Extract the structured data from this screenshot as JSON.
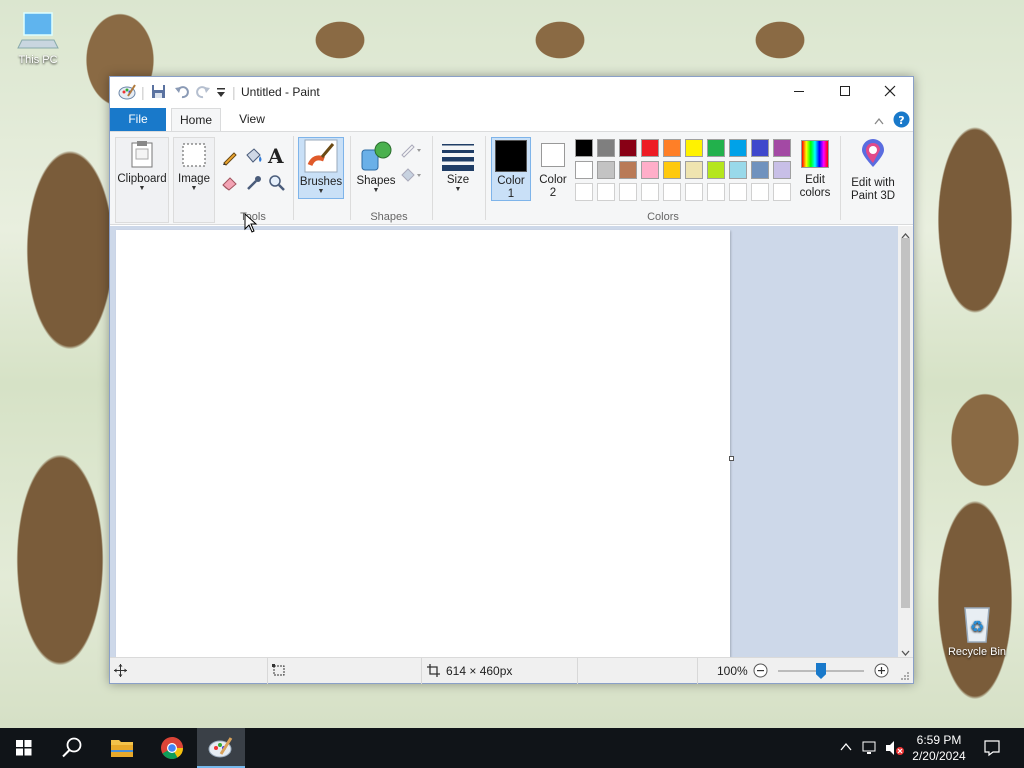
{
  "desktop": {
    "this_pc": "This PC",
    "recycle_bin": "Recycle Bin"
  },
  "window": {
    "title": "Untitled - Paint"
  },
  "tabs": {
    "file": "File",
    "home": "Home",
    "view": "View"
  },
  "ribbon": {
    "clipboard": "Clipboard",
    "image": "Image",
    "tools": "Tools",
    "brushes": "Brushes",
    "shapes_btn": "Shapes",
    "shapes_group": "Shapes",
    "size": "Size",
    "color1_a": "Color",
    "color1_b": "1",
    "color2_a": "Color",
    "color2_b": "2",
    "edit_colors_a": "Edit",
    "edit_colors_b": "colors",
    "paint3d_a": "Edit with",
    "paint3d_b": "Paint 3D",
    "colors_group": "Colors"
  },
  "palette": {
    "row1": [
      "#000000",
      "#7f7f7f",
      "#880015",
      "#ed1c24",
      "#ff7f27",
      "#fff200",
      "#22b14c",
      "#00a2e8",
      "#3f48cc",
      "#a349a4"
    ],
    "row2": [
      "#ffffff",
      "#c3c3c3",
      "#b97a57",
      "#ffaec9",
      "#ffc90e",
      "#efe4b0",
      "#b5e61d",
      "#99d9ea",
      "#7092be",
      "#c8bfe7"
    ]
  },
  "colors": {
    "color1": "#000000",
    "color2": "#ffffff",
    "accent": "#1979ca"
  },
  "status": {
    "canvas_size": "614 × 460px",
    "zoom": "100%",
    "zoom_fraction": 0.5
  },
  "taskbar": {
    "time": "6:59 PM",
    "date": "2/20/2024"
  }
}
